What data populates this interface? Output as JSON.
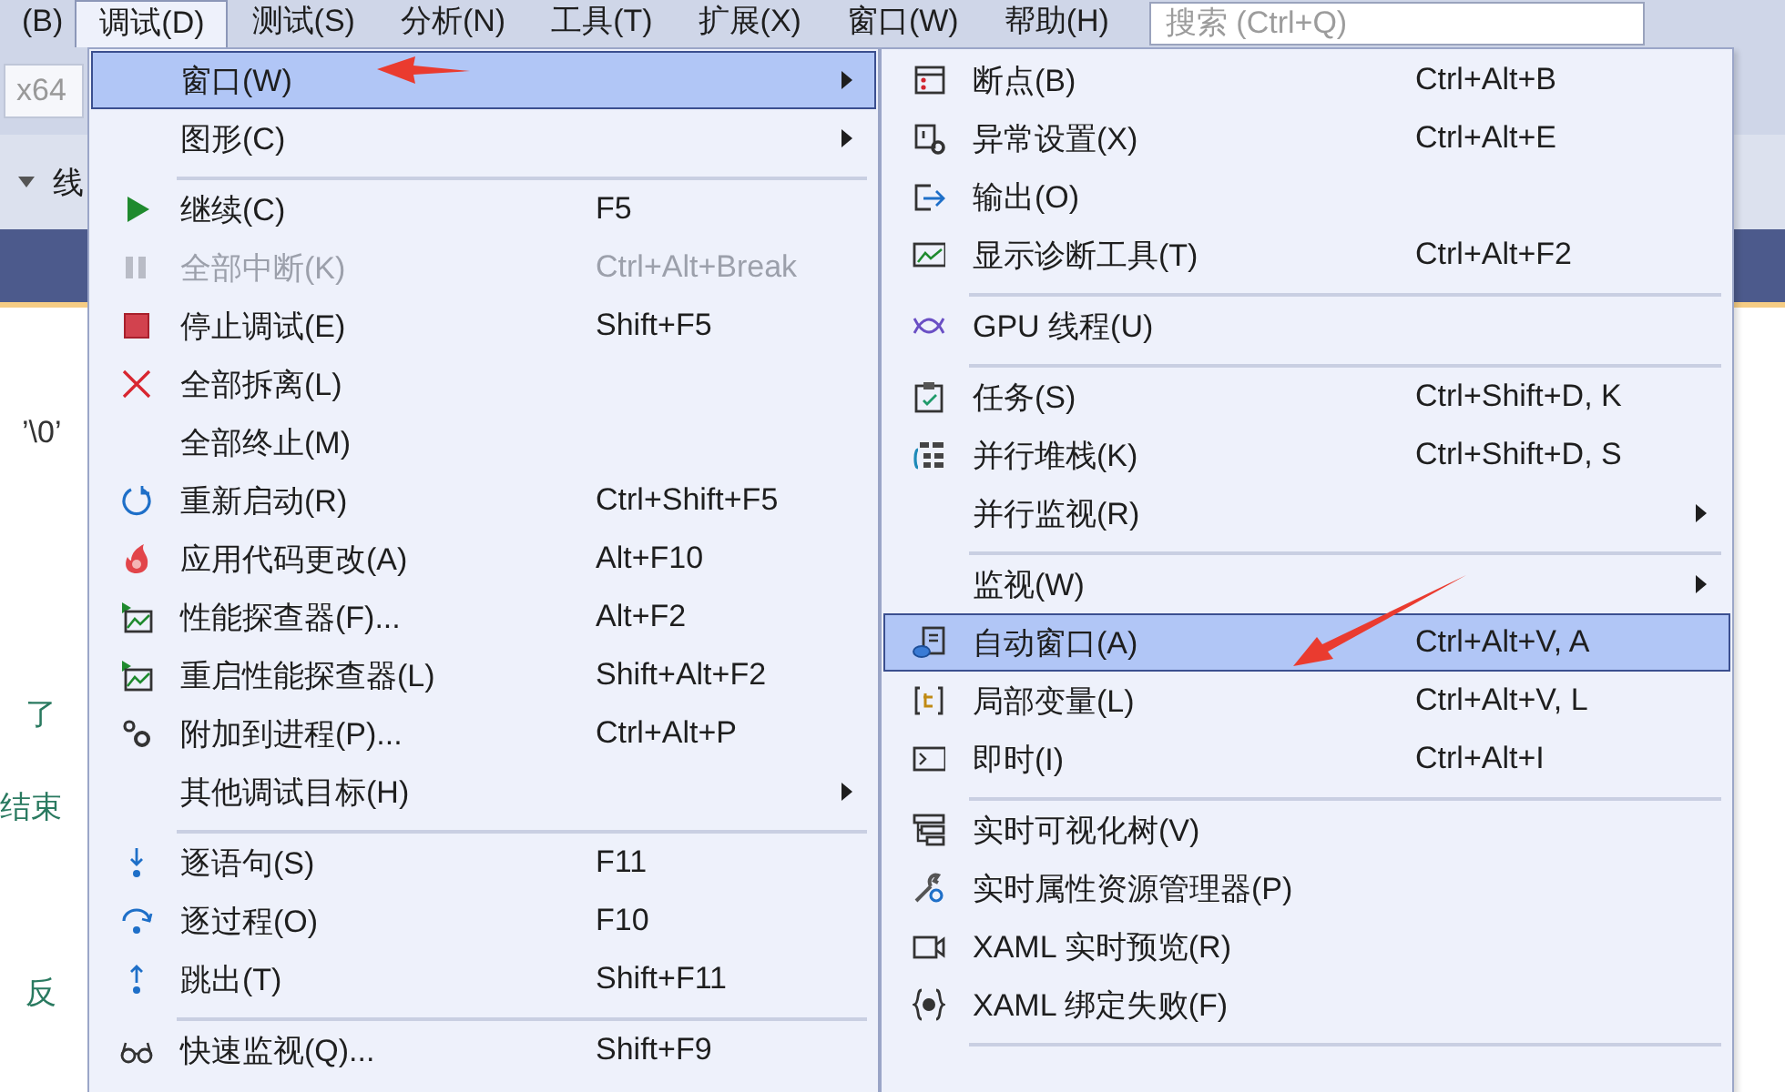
{
  "menu_bar": {
    "items": [
      {
        "label": "(B)",
        "selected": false
      },
      {
        "label": "调试(D)",
        "selected": true
      },
      {
        "label": "测试(S)",
        "selected": false
      },
      {
        "label": "分析(N)",
        "selected": false
      },
      {
        "label": "工具(T)",
        "selected": false
      },
      {
        "label": "扩展(X)",
        "selected": false
      },
      {
        "label": "窗口(W)",
        "selected": false
      },
      {
        "label": "帮助(H)",
        "selected": false
      }
    ]
  },
  "search": {
    "placeholder": "搜索 (Ctrl+Q)"
  },
  "toolbar": {
    "platform": "x64",
    "label": "线"
  },
  "editor_lines": [
    {
      "text": "’\\0’",
      "kind": "code"
    },
    {
      "text": "了",
      "kind": "comment"
    },
    {
      "text": "结束",
      "kind": "comment"
    },
    {
      "text": "反",
      "kind": "comment"
    }
  ],
  "debug_menu": [
    {
      "kind": "item",
      "label": "窗口(W)",
      "submenu": true,
      "selected": true,
      "disabled": false
    },
    {
      "kind": "item",
      "label": "图形(C)",
      "submenu": true,
      "selected": false,
      "disabled": false
    },
    {
      "kind": "separator"
    },
    {
      "kind": "item",
      "label": "继续(C)",
      "shortcut": "F5",
      "submenu": false,
      "selected": false,
      "disabled": false
    },
    {
      "kind": "item",
      "label": "全部中断(K)",
      "shortcut": "Ctrl+Alt+Break",
      "submenu": false,
      "selected": false,
      "disabled": true
    },
    {
      "kind": "item",
      "label": "停止调试(E)",
      "shortcut": "Shift+F5",
      "submenu": false,
      "selected": false,
      "disabled": false
    },
    {
      "kind": "item",
      "label": "全部拆离(L)",
      "submenu": false,
      "selected": false,
      "disabled": false
    },
    {
      "kind": "item",
      "label": "全部终止(M)",
      "submenu": false,
      "selected": false,
      "disabled": false
    },
    {
      "kind": "item",
      "label": "重新启动(R)",
      "shortcut": "Ctrl+Shift+F5",
      "submenu": false,
      "selected": false,
      "disabled": false
    },
    {
      "kind": "item",
      "label": "应用代码更改(A)",
      "shortcut": "Alt+F10",
      "submenu": false,
      "selected": false,
      "disabled": false
    },
    {
      "kind": "item",
      "label": "性能探查器(F)...",
      "shortcut": "Alt+F2",
      "submenu": false,
      "selected": false,
      "disabled": false
    },
    {
      "kind": "item",
      "label": "重启性能探查器(L)",
      "shortcut": "Shift+Alt+F2",
      "submenu": false,
      "selected": false,
      "disabled": false
    },
    {
      "kind": "item",
      "label": "附加到进程(P)...",
      "shortcut": "Ctrl+Alt+P",
      "submenu": false,
      "selected": false,
      "disabled": false
    },
    {
      "kind": "item",
      "label": "其他调试目标(H)",
      "submenu": true,
      "selected": false,
      "disabled": false
    },
    {
      "kind": "separator"
    },
    {
      "kind": "item",
      "label": "逐语句(S)",
      "shortcut": "F11",
      "submenu": false,
      "selected": false,
      "disabled": false
    },
    {
      "kind": "item",
      "label": "逐过程(O)",
      "shortcut": "F10",
      "submenu": false,
      "selected": false,
      "disabled": false
    },
    {
      "kind": "item",
      "label": "跳出(T)",
      "shortcut": "Shift+F11",
      "submenu": false,
      "selected": false,
      "disabled": false
    },
    {
      "kind": "separator"
    },
    {
      "kind": "item",
      "label": "快速监视(Q)...",
      "shortcut": "Shift+F9",
      "submenu": false,
      "selected": false,
      "disabled": false
    }
  ],
  "window_submenu": [
    {
      "kind": "item",
      "label": "断点(B)",
      "shortcut": "Ctrl+Alt+B",
      "submenu": false,
      "selected": false
    },
    {
      "kind": "item",
      "label": "异常设置(X)",
      "shortcut": "Ctrl+Alt+E",
      "submenu": false,
      "selected": false
    },
    {
      "kind": "item",
      "label": "输出(O)",
      "submenu": false,
      "selected": false
    },
    {
      "kind": "item",
      "label": "显示诊断工具(T)",
      "shortcut": "Ctrl+Alt+F2",
      "submenu": false,
      "selected": false
    },
    {
      "kind": "separator"
    },
    {
      "kind": "item",
      "label": "GPU 线程(U)",
      "submenu": false,
      "selected": false
    },
    {
      "kind": "separator"
    },
    {
      "kind": "item",
      "label": "任务(S)",
      "shortcut": "Ctrl+Shift+D, K",
      "submenu": false,
      "selected": false
    },
    {
      "kind": "item",
      "label": "并行堆栈(K)",
      "shortcut": "Ctrl+Shift+D, S",
      "submenu": false,
      "selected": false
    },
    {
      "kind": "item",
      "label": "并行监视(R)",
      "submenu": true,
      "selected": false
    },
    {
      "kind": "separator"
    },
    {
      "kind": "item",
      "label": "监视(W)",
      "submenu": true,
      "selected": false
    },
    {
      "kind": "item",
      "label": "自动窗口(A)",
      "shortcut": "Ctrl+Alt+V, A",
      "submenu": false,
      "selected": true
    },
    {
      "kind": "item",
      "label": "局部变量(L)",
      "shortcut": "Ctrl+Alt+V, L",
      "submenu": false,
      "selected": false
    },
    {
      "kind": "item",
      "label": "即时(I)",
      "shortcut": "Ctrl+Alt+I",
      "submenu": false,
      "selected": false
    },
    {
      "kind": "separator"
    },
    {
      "kind": "item",
      "label": "实时可视化树(V)",
      "submenu": false,
      "selected": false
    },
    {
      "kind": "item",
      "label": "实时属性资源管理器(P)",
      "submenu": false,
      "selected": false
    },
    {
      "kind": "item",
      "label": "XAML 实时预览(R)",
      "submenu": false,
      "selected": false
    },
    {
      "kind": "item",
      "label": "XAML 绑定失败(F)",
      "submenu": false,
      "selected": false
    },
    {
      "kind": "separator"
    }
  ]
}
